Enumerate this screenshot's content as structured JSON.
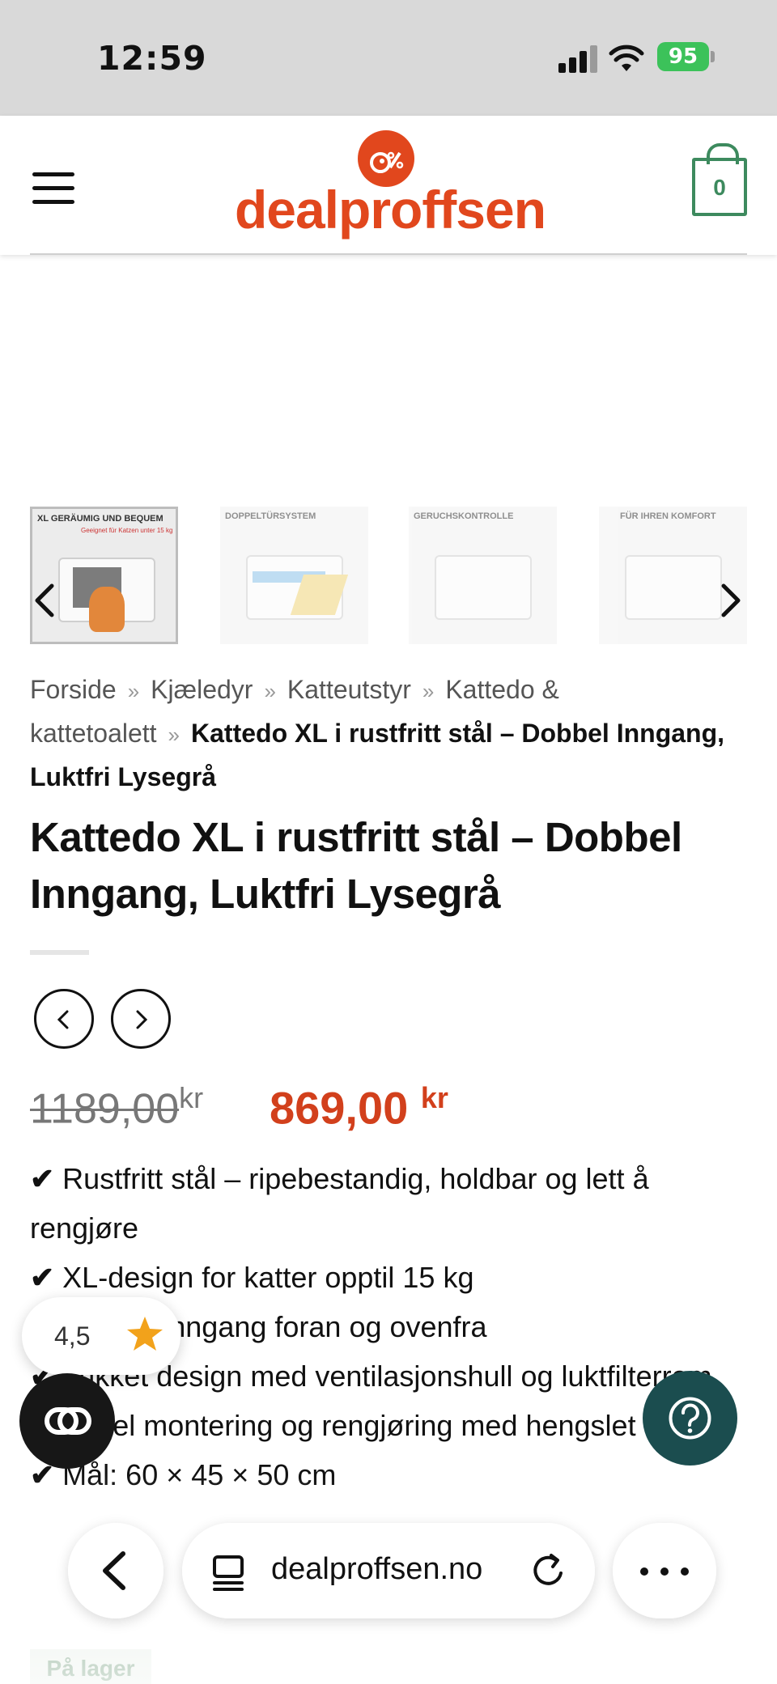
{
  "status_bar": {
    "time": "12:59",
    "battery": "95"
  },
  "header": {
    "logo_text": "dealproffsen",
    "cart_count": "0"
  },
  "gallery": {
    "thumbnails": [
      {
        "caption": "XL GERÄUMIG UND BEQUEM",
        "subcaption": "Geeignet für Katzen unter 15 kg"
      },
      {
        "caption": "DOPPELTÜRSYSTEM"
      },
      {
        "caption": "GERUCHSKONTROLLE"
      },
      {
        "caption": "FÜR IHREN KOMFORT"
      }
    ]
  },
  "breadcrumb": {
    "items": [
      "Forside",
      "Kjæledyr",
      "Katteutstyr",
      "Kattedo & kattetoalett"
    ],
    "separator": "»",
    "current": "Kattedo XL i rustfritt stål – Dobbel Inngang, Luktfri Lysegrå"
  },
  "product": {
    "title": "Kattedo XL i rustfritt stål – Dobbel Inngang, Luktfri Lysegrå",
    "price_old": "1189,00",
    "price_new": "869,00",
    "currency": "kr",
    "check_mark": "✔",
    "features": [
      "Rustfritt stål – ripebestandig, holdbar og lett å rengjøre",
      "XL-design for katter opptil 15 kg",
      "Dobbel inngang foran og ovenfra",
      "Lukket design med ventilasjonshull og luktfilterrom",
      "Enkel montering og rengjøring med hengslet lokk"
    ],
    "partial_feature": "Mål: 60 × 45 × 50 cm",
    "stock": "På lager"
  },
  "rating": {
    "value": "4,5"
  },
  "browser": {
    "url": "dealproffsen.no"
  },
  "colors": {
    "accent": "#e1471d",
    "price": "#d2401c",
    "cart": "#3d8a5e",
    "help": "#1b4d4f"
  }
}
